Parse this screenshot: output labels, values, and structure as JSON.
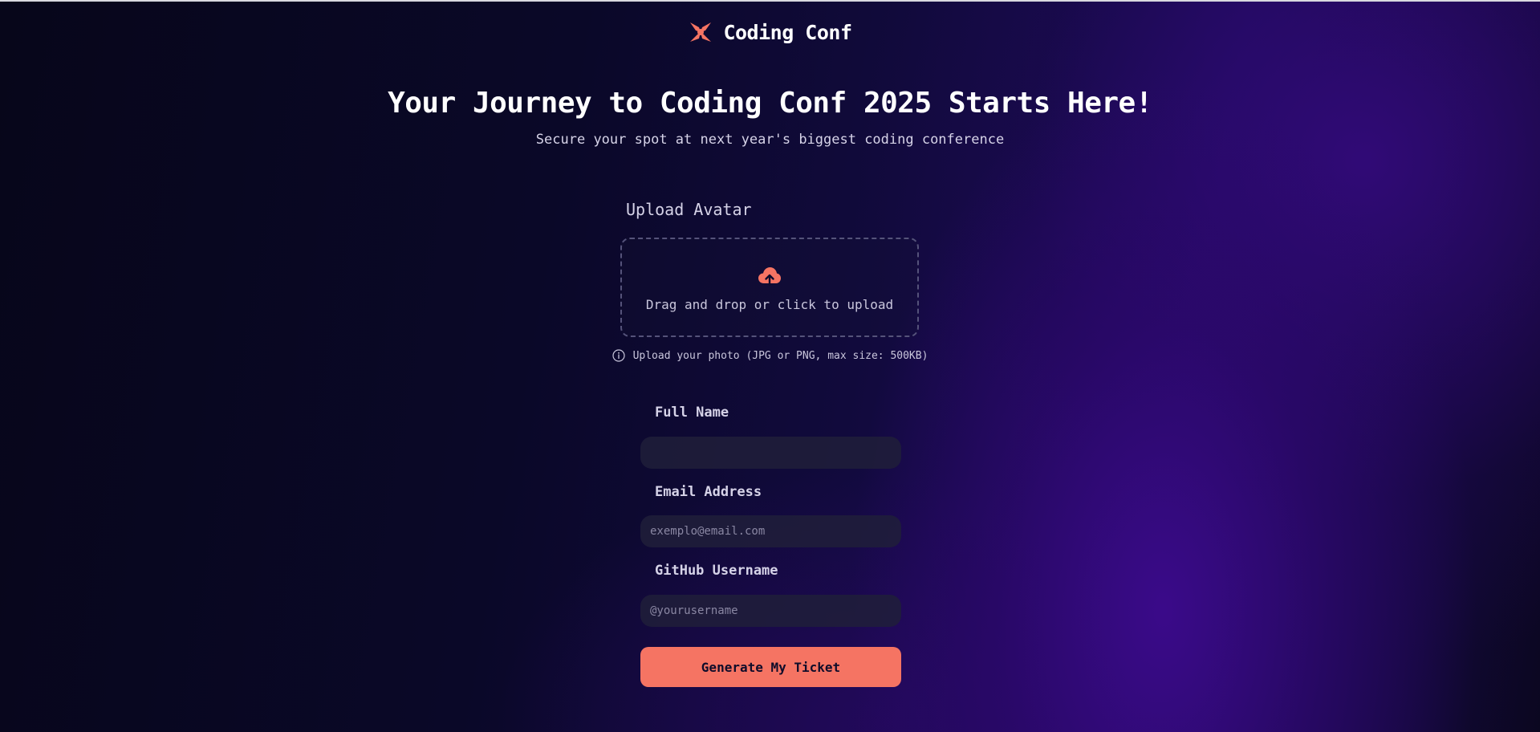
{
  "header": {
    "brand_name": "Coding Conf",
    "logo_icon": "coding-conf-logo-icon"
  },
  "hero": {
    "title": "Your Journey to Coding Conf 2025 Starts Here!",
    "subtitle": "Secure your spot at next year's biggest coding conference"
  },
  "upload": {
    "label": "Upload Avatar",
    "dropzone_text": "Drag and drop or click to upload",
    "dropzone_icon": "upload-cloud-icon",
    "hint_icon": "info-icon",
    "hint_text": "Upload your photo (JPG or PNG, max size: 500KB)"
  },
  "form": {
    "full_name": {
      "label": "Full Name",
      "value": "",
      "placeholder": ""
    },
    "email": {
      "label": "Email Address",
      "value": "",
      "placeholder": "exemplo@email.com"
    },
    "github": {
      "label": "GitHub Username",
      "value": "",
      "placeholder": "@yourusername"
    },
    "submit_label": "Generate My Ticket"
  },
  "colors": {
    "accent": "#f57463",
    "background_dark": "#0a0828",
    "background_purple": "#2a0a7a",
    "text_primary": "#ffffff",
    "text_muted": "#d6d3e8"
  }
}
